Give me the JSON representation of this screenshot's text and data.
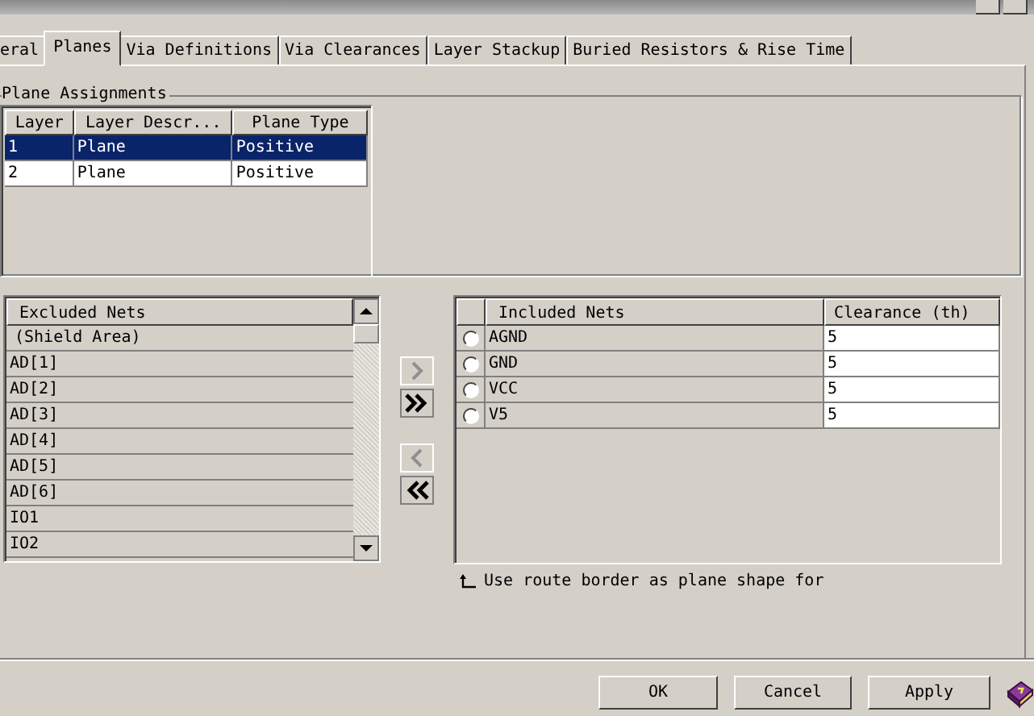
{
  "tabs": [
    {
      "label": "eral",
      "selected": false
    },
    {
      "label": "Planes",
      "selected": true
    },
    {
      "label": "Via Definitions",
      "selected": false
    },
    {
      "label": "Via Clearances",
      "selected": false
    },
    {
      "label": "Layer Stackup",
      "selected": false
    },
    {
      "label": "Buried Resistors & Rise Time",
      "selected": false
    }
  ],
  "plane_assignments": {
    "title": "Plane Assignments",
    "columns": [
      "Layer",
      "Layer Descr...",
      "Plane Type"
    ],
    "rows": [
      {
        "cells": [
          "1",
          "Plane",
          "Positive"
        ],
        "selected": true
      },
      {
        "cells": [
          "2",
          "Plane",
          "Positive"
        ],
        "selected": false
      }
    ]
  },
  "excluded_nets": {
    "column": "Excluded Nets",
    "rows": [
      "(Shield Area)",
      "AD[1]",
      "AD[2]",
      "AD[3]",
      "AD[4]",
      "AD[5]",
      "AD[6]",
      "IO1",
      "IO2"
    ]
  },
  "included_nets": {
    "columns": [
      "Included Nets",
      "Clearance (th)"
    ],
    "rows": [
      {
        "net": "AGND",
        "clearance": "5",
        "selected": false
      },
      {
        "net": "GND",
        "clearance": "5",
        "selected": false
      },
      {
        "net": "VCC",
        "clearance": "5",
        "selected": false
      },
      {
        "net": "V5",
        "clearance": "5",
        "selected": false
      }
    ]
  },
  "note": "Use route border as plane shape for",
  "buttons": [
    {
      "label": "OK"
    },
    {
      "label": "Cancel"
    },
    {
      "label": "Apply"
    }
  ]
}
